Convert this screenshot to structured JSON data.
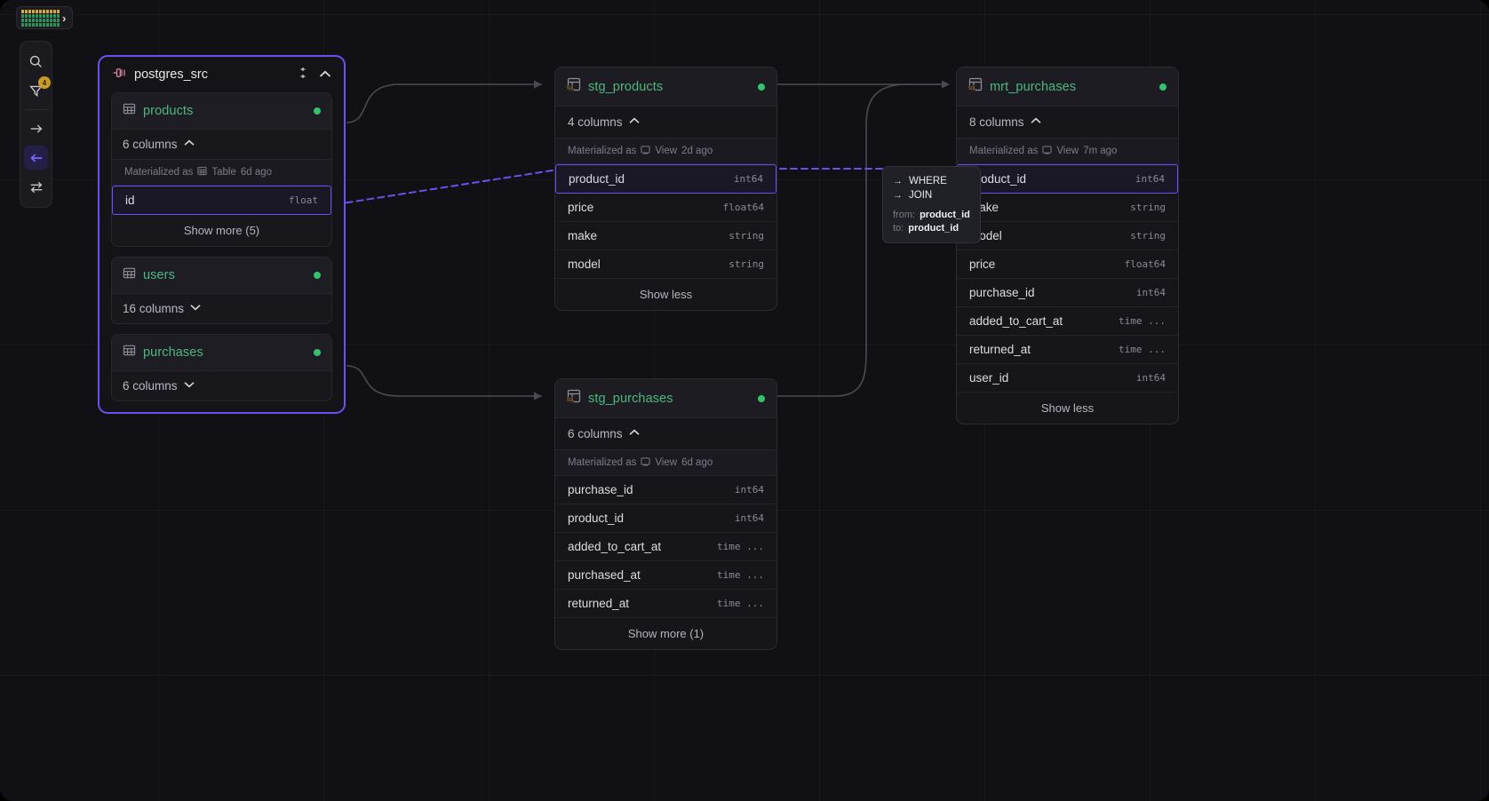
{
  "logo": {
    "icon": "grid-logo-icon",
    "chevron": "›"
  },
  "toolbar": {
    "items": [
      {
        "name": "search-icon",
        "label": "Search",
        "active": false,
        "badge": null
      },
      {
        "name": "filter-icon",
        "label": "Filter",
        "active": false,
        "badge": "4"
      },
      {
        "name": "arrow-right-icon",
        "label": "Downstream",
        "active": false,
        "badge": null
      },
      {
        "name": "arrow-left-icon",
        "label": "Upstream",
        "active": true,
        "badge": null
      },
      {
        "name": "bidirectional-arrows-icon",
        "label": "Both directions",
        "active": false,
        "badge": null
      }
    ]
  },
  "accent": {
    "purple": "#6b4ff0",
    "green": "#4eb880",
    "status_dot": "#34c26a",
    "badge": "#c79a2a"
  },
  "nodes": {
    "source": {
      "title": "postgres_src",
      "icon": "database-connector-icon",
      "collapse_icon": "chevron-up-icon",
      "menu_icon": "vertical-options-icon",
      "tables": [
        {
          "name": "products",
          "columns_label": "6 columns",
          "expanded": true,
          "materialized": "Materialized as",
          "materialized_kind": "Table",
          "materialized_age": "6d ago",
          "materialized_icon": "table-icon",
          "columns": [
            {
              "name": "id",
              "type": "float",
              "highlighted": true
            }
          ],
          "footer": "Show more (5)"
        },
        {
          "name": "users",
          "columns_label": "16 columns",
          "expanded": false,
          "columns": [],
          "footer": null
        },
        {
          "name": "purchases",
          "columns_label": "6 columns",
          "expanded": false,
          "columns": [],
          "footer": null
        }
      ]
    },
    "stg_products": {
      "title": "stg_products",
      "icon": "sql-model-icon",
      "columns_label": "4 columns",
      "collapse_icon": "chevron-up-icon",
      "materialized": "Materialized as",
      "materialized_kind": "View",
      "materialized_age": "2d ago",
      "materialized_icon": "view-icon",
      "columns": [
        {
          "name": "product_id",
          "type": "int64",
          "highlighted": true
        },
        {
          "name": "price",
          "type": "float64",
          "highlighted": false
        },
        {
          "name": "make",
          "type": "string",
          "highlighted": false
        },
        {
          "name": "model",
          "type": "string",
          "highlighted": false
        }
      ],
      "footer": "Show less"
    },
    "stg_purchases": {
      "title": "stg_purchases",
      "icon": "sql-model-icon",
      "columns_label": "6 columns",
      "collapse_icon": "chevron-up-icon",
      "materialized": "Materialized as",
      "materialized_kind": "View",
      "materialized_age": "6d ago",
      "materialized_icon": "view-icon",
      "columns": [
        {
          "name": "purchase_id",
          "type": "int64",
          "highlighted": false
        },
        {
          "name": "product_id",
          "type": "int64",
          "highlighted": false
        },
        {
          "name": "added_to_cart_at",
          "type": "time ...",
          "highlighted": false
        },
        {
          "name": "purchased_at",
          "type": "time ...",
          "highlighted": false
        },
        {
          "name": "returned_at",
          "type": "time ...",
          "highlighted": false
        }
      ],
      "footer": "Show more (1)"
    },
    "mrt_purchases": {
      "title": "mrt_purchases",
      "icon": "sql-model-icon",
      "columns_label": "8 columns",
      "collapse_icon": "chevron-up-icon",
      "materialized": "Materialized as",
      "materialized_kind": "View",
      "materialized_age": "7m ago",
      "materialized_icon": "view-icon",
      "columns": [
        {
          "name": "product_id",
          "type": "int64",
          "highlighted": true
        },
        {
          "name": "make",
          "type": "string",
          "highlighted": false
        },
        {
          "name": "model",
          "type": "string",
          "highlighted": false
        },
        {
          "name": "price",
          "type": "float64",
          "highlighted": false
        },
        {
          "name": "purchase_id",
          "type": "int64",
          "highlighted": false
        },
        {
          "name": "added_to_cart_at",
          "type": "time ...",
          "highlighted": false
        },
        {
          "name": "returned_at",
          "type": "time ...",
          "highlighted": false
        },
        {
          "name": "user_id",
          "type": "int64",
          "highlighted": false
        }
      ],
      "footer": "Show less"
    }
  },
  "tooltip": {
    "clauses": [
      {
        "arrow": "→",
        "label": "WHERE"
      },
      {
        "arrow": "→",
        "label": "JOIN"
      }
    ],
    "from_key": "from:",
    "from_value": "product_id",
    "to_key": "to:",
    "to_value": "product_id"
  }
}
